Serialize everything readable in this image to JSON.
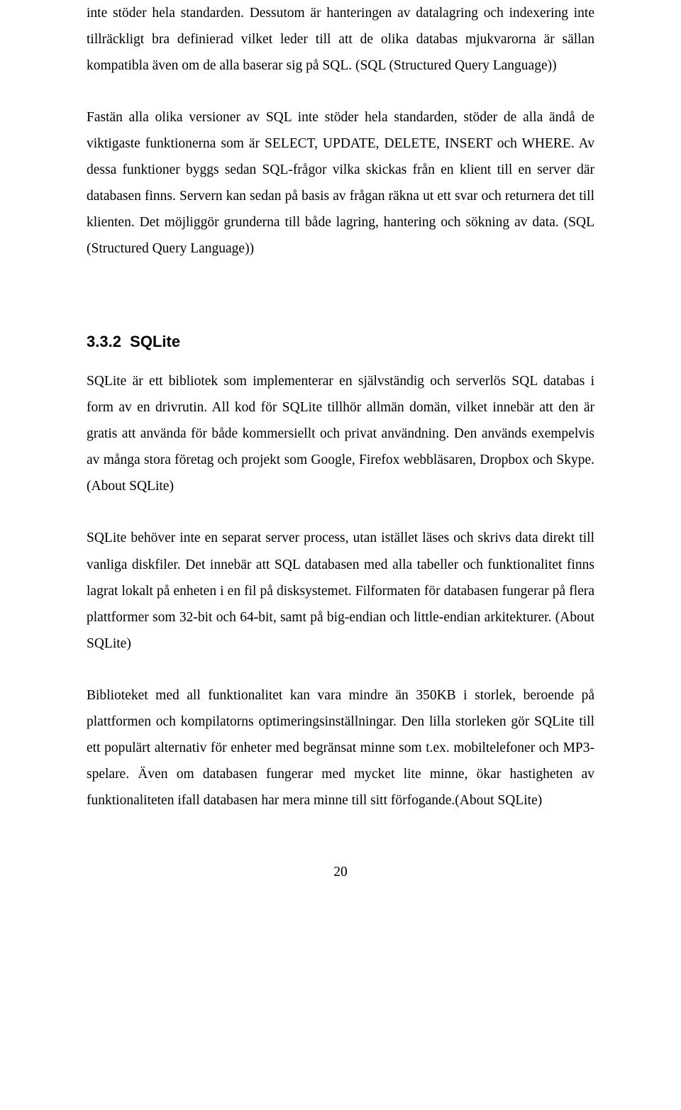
{
  "paragraphs": {
    "p1": "inte stöder hela standarden. Dessutom är hanteringen av datalagring och indexering inte tillräckligt bra definierad vilket leder till att de olika databas mjukvarorna är sällan kompatibla även om de alla baserar sig på SQL. (SQL (Structured Query Language))",
    "p2": "Fastän alla olika versioner av SQL inte stöder hela standarden, stöder de alla ändå de viktigaste funktionerna som är SELECT, UPDATE, DELETE, INSERT och WHERE. Av dessa funktioner byggs sedan SQL-frågor vilka skickas från en klient till en server där databasen finns. Servern kan sedan på basis av frågan räkna ut ett svar och returnera det till klienten. Det möjliggör grunderna till både lagring, hantering och sökning av data. (SQL (Structured Query Language))",
    "p3": "SQLite är ett bibliotek som implementerar en självständig och serverlös SQL databas i form av en drivrutin. All kod för SQLite tillhör allmän domän, vilket innebär att den är gratis att använda för både kommersiellt och privat användning. Den används exempelvis av många stora företag och projekt som Google, Firefox webbläsaren, Dropbox och Skype. (About SQLite)",
    "p4": "SQLite behöver inte en separat server process, utan istället läses och skrivs data direkt till vanliga diskfiler. Det innebär att SQL databasen med alla tabeller och funktionalitet finns lagrat lokalt på enheten i en fil på disksystemet. Filformaten för databasen fungerar på flera plattformer som 32-bit och 64-bit, samt på big-endian och little-endian arkitekturer. (About SQLite)",
    "p5": "Biblioteket med all funktionalitet kan vara mindre än 350KB i storlek, beroende på plattformen och kompilatorns optimeringsinställningar. Den lilla storleken gör SQLite till ett populärt alternativ för enheter med begränsat minne som t.ex. mobiltelefoner och MP3-spelare. Även om databasen fungerar med mycket lite minne, ökar hastigheten av funktionaliteten ifall databasen har mera minne till sitt förfogande.(About SQLite)"
  },
  "heading": {
    "number": "3.3.2",
    "title": "SQLite"
  },
  "pageNumber": "20"
}
